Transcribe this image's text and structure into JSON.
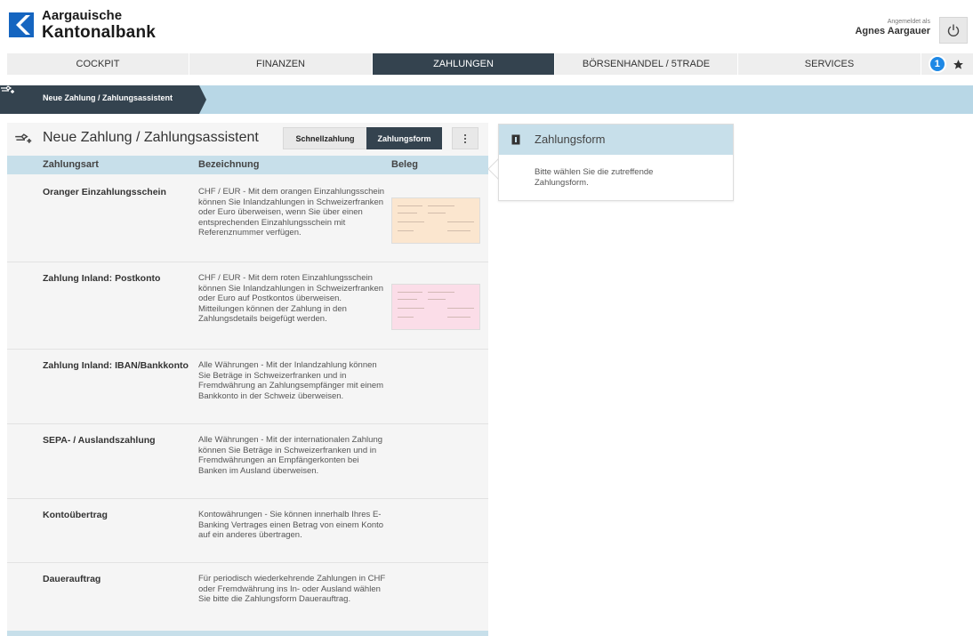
{
  "bank": {
    "name_line1": "Aargauische",
    "name_line2": "Kantonalbank"
  },
  "user": {
    "caption": "Angemeldet als",
    "name": "Agnes Aargauer"
  },
  "nav": {
    "items": [
      {
        "label": "COCKPIT",
        "active": false
      },
      {
        "label": "FINANZEN",
        "active": false
      },
      {
        "label": "ZAHLUNGEN",
        "active": true
      },
      {
        "label": "BÖRSENHANDEL / 5TRADE",
        "active": false
      },
      {
        "label": "SERVICES",
        "active": false
      }
    ],
    "notification_count": "1"
  },
  "breadcrumb": {
    "label": "Neue Zahlung / Zahlungsassistent"
  },
  "panel": {
    "title": "Neue Zahlung / Zahlungsassistent",
    "buttons": {
      "quick": "Schnellzahlung",
      "form": "Zahlungsform"
    },
    "columns": {
      "type": "Zahlungsart",
      "description": "Bezeichnung",
      "receipt": "Beleg"
    },
    "rows": [
      {
        "name": "Oranger Einzahlungsschein",
        "description": "CHF / EUR - Mit dem orangen Einzahlungsschein können Sie Inlandzahlungen in Schweizerfranken oder Euro überweisen, wenn Sie über einen entsprechenden Einzahlungsschein mit Referenznummer verfügen.",
        "thumb": "orange"
      },
      {
        "name": "Zahlung Inland: Postkonto",
        "description": "CHF / EUR - Mit dem roten Einzahlungsschein können Sie Inlandzahlungen in Schweizerfranken oder Euro auf Postkontos überweisen. Mitteilungen können der Zahlung in den Zahlungsdetails beigefügt werden.",
        "thumb": "pink"
      },
      {
        "name": "Zahlung Inland: IBAN/Bankkonto",
        "description": "Alle Währungen - Mit der Inlandzahlung können Sie Beträge in Schweizerfranken und in Fremdwährung an Zahlungsempfänger mit einem Bankkonto in der Schweiz überweisen.",
        "thumb": ""
      },
      {
        "name": "SEPA- / Auslandszahlung",
        "description": "Alle Währungen - Mit der internationalen Zahlung können Sie Beträge in Schweizerfranken und in Fremdwährungen an Empfängerkonten bei Banken im Ausland überweisen.",
        "thumb": ""
      },
      {
        "name": "Kontoübertrag",
        "description": "Kontowährungen - Sie können innerhalb Ihres E-Banking Vertrages einen Betrag von einem Konto auf ein anderes übertragen.",
        "thumb": ""
      },
      {
        "name": "Dauerauftrag",
        "description": "Für periodisch wiederkehrende Zahlungen in CHF oder Fremdwährung ins In- oder Ausland wählen Sie bitte die Zahlungsform Dauerauftrag.",
        "thumb": ""
      }
    ]
  },
  "info_card": {
    "title": "Zahlungsform",
    "body": "Bitte wählen Sie die zutreffende Zahlungsform."
  },
  "colors": {
    "accent_dark": "#34434f",
    "accent_light": "#c7dfea",
    "band": "#b8d7e6",
    "logo_blue": "#1565c0",
    "badge_blue": "#1e88e5"
  }
}
